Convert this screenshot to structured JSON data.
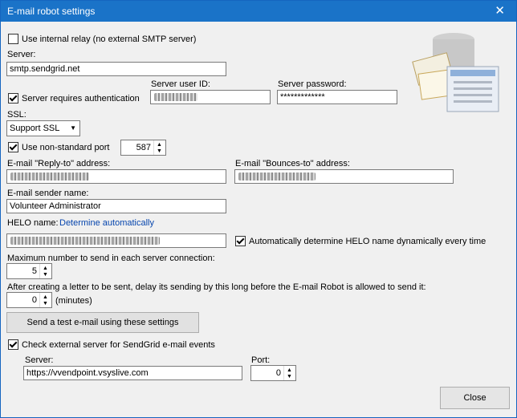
{
  "window": {
    "title": "E-mail robot settings",
    "close_label": "✕"
  },
  "relay": {
    "label": "Use internal relay (no external SMTP server)",
    "checked": false
  },
  "server": {
    "label": "Server:",
    "value": "smtp.sendgrid.net"
  },
  "auth": {
    "label": "Server requires authentication",
    "checked": true,
    "user_id_label": "Server user ID:",
    "password_label": "Server password:",
    "password_value": "*************"
  },
  "ssl": {
    "label": "SSL:",
    "value": "Support SSL"
  },
  "port": {
    "label": "Use non-standard port",
    "checked": true,
    "value": "587"
  },
  "reply_to": {
    "label": "E-mail \"Reply-to\" address:"
  },
  "bounces_to": {
    "label": "E-mail \"Bounces-to\" address:"
  },
  "sender": {
    "label": "E-mail sender name:",
    "value": "Volunteer Administrator"
  },
  "helo": {
    "label": "HELO name:",
    "link": "Determine automatically",
    "auto_label": "Automatically determine HELO name dynamically every time",
    "auto_checked": true
  },
  "max_send": {
    "label": "Maximum number to send in each server connection:",
    "value": "5"
  },
  "delay": {
    "label": "After creating a letter to be sent, delay its sending by this long before the E-mail Robot is allowed to send it:",
    "value": "0",
    "unit": "(minutes)"
  },
  "test_button": "Send a test e-mail using these settings",
  "external": {
    "label": "Check external server for SendGrid e-mail events",
    "checked": true,
    "server_label": "Server:",
    "server_value": "https://vvendpoint.vsyslive.com",
    "port_label": "Port:",
    "port_value": "0"
  },
  "close_button": "Close"
}
